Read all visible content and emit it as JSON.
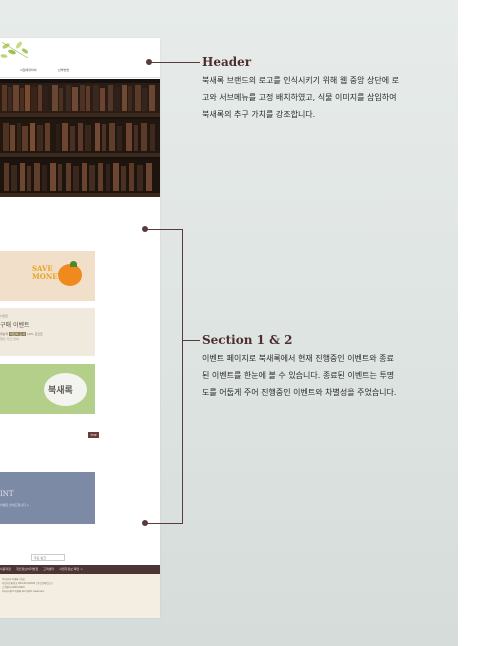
{
  "site": {
    "nav_items": [
      "서점에대하여",
      "납부방법"
    ],
    "banners": {
      "save_money": "SAVE MONEY",
      "event_small_top": "이벤트",
      "event_title": "구매 이벤트",
      "event_sub_prefix": "대상작",
      "event_sub_highlight": "어린이 도서",
      "event_sub_suffix": "10% 포인트",
      "event_small_bottom": "행사 기간 안내",
      "logo_rock": "북새록",
      "notice_text": "INT",
      "notice_sub": "이벤트 안내드립니다 >"
    },
    "top_button": "TOP",
    "footer": {
      "select_label": "주요 링크",
      "links": [
        "이용약관",
        "개인정보처리방침",
        "고객센터",
        "사업자정보 확인 >"
      ],
      "info_lines": [
        "주식회사 북새록 | 대표",
        "사업자등록번호 000-00-00000 | 통신판매업신고",
        "고객센터 0000-0000",
        "Copyright 북새록 All rights reserved."
      ]
    }
  },
  "annotations": [
    {
      "title": "Header",
      "body": "북새록 브랜드의 로고를 인식시키기 위해 웹 중앙 상단에 로고와 서브메뉴를 고정 배치하였고, 식물 이미지를 삽입하여 북새록의 추구 가치를 강조합니다."
    },
    {
      "title": "Section 1 & 2",
      "body": "이벤트 페이지로 북새록에서 현재 진행중인 이벤트와 종료된 이벤트를 한눈에 볼 수 있습니다. 종료된 이벤트는 투명도를 어둡게 주어 진행중인 이벤트와 차별성을 주었습니다."
    }
  ],
  "colors": {
    "accent": "#5a3b3c",
    "background": "#dfe5e3",
    "footer_bar": "#4b3535",
    "footer_info": "#f3eee1"
  }
}
